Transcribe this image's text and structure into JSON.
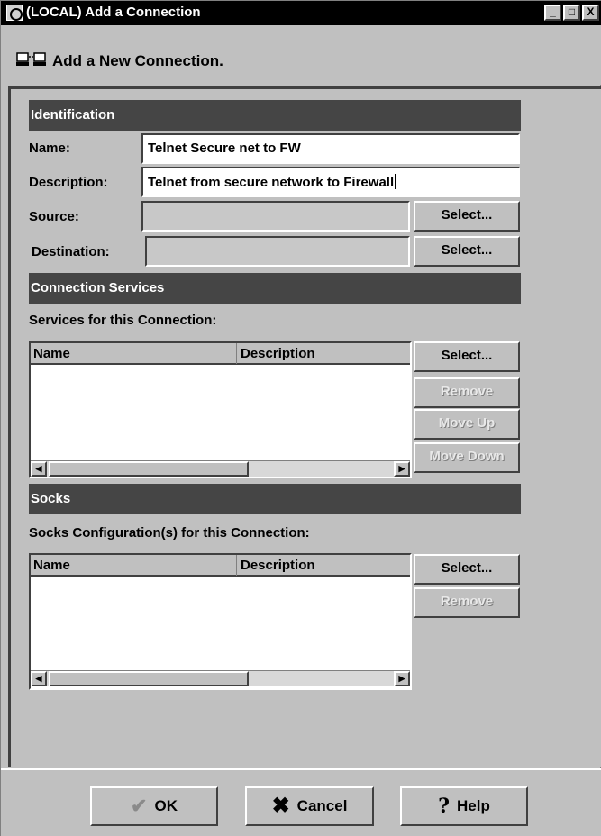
{
  "window": {
    "title": "(LOCAL) Add a Connection",
    "minimize": "_",
    "maximize": "□",
    "close": "X"
  },
  "heading": "Add a New Connection.",
  "identification": {
    "section_label": "Identification",
    "name_label": "Name:",
    "name_value": "Telnet Secure net to FW",
    "description_label": "Description:",
    "description_value": "Telnet from secure network to Firewall",
    "source_label": "Source:",
    "source_value": "",
    "source_select": "Select...",
    "destination_label": "Destination:",
    "destination_value": "",
    "destination_select": "Select..."
  },
  "services": {
    "section_label": "Connection Services",
    "list_label": "Services for this Connection:",
    "columns": [
      "Name",
      "Description"
    ],
    "rows": [],
    "select": "Select...",
    "remove": "Remove",
    "move_up": "Move Up",
    "move_down": "Move Down"
  },
  "socks": {
    "section_label": "Socks",
    "list_label": "Socks Configuration(s) for this Connection:",
    "columns": [
      "Name",
      "Description"
    ],
    "rows": [],
    "select": "Select...",
    "remove": "Remove"
  },
  "footer": {
    "ok": "OK",
    "cancel": "Cancel",
    "help": "Help"
  },
  "icons": {
    "ok": "checkmark-icon",
    "cancel": "x-icon",
    "help": "question-icon"
  }
}
